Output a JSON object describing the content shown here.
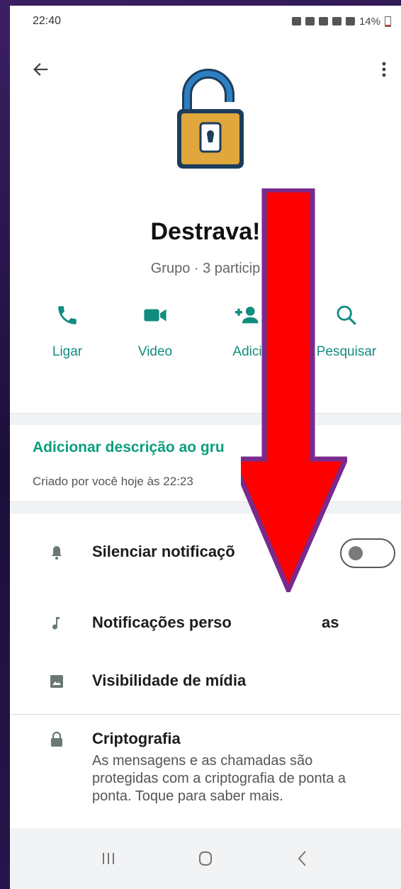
{
  "status_bar": {
    "time": "22:40",
    "battery": "14%"
  },
  "group": {
    "name": "Destrava!",
    "subtitle": "Grupo · 3 particip"
  },
  "actions": [
    {
      "label": "Ligar",
      "icon": "phone-icon"
    },
    {
      "label": "Video",
      "icon": "video-icon"
    },
    {
      "label": "Adici",
      "icon": "add-person-icon"
    },
    {
      "label": "Pesquisar",
      "icon": "search-icon"
    }
  ],
  "description": {
    "add_link": "Adicionar descrição ao gru",
    "created": "Criado por você hoje às 22:23"
  },
  "settings": [
    {
      "label": "Silenciar notificaçõ",
      "icon": "bell-icon",
      "toggle": false
    },
    {
      "label": "Notificações perso",
      "label_end": "as",
      "icon": "music-note-icon"
    },
    {
      "label": "Visibilidade de mídia",
      "icon": "image-icon"
    }
  ],
  "encryption": {
    "title": "Criptografia",
    "description": "As mensagens e as chamadas são protegidas com a criptografia de ponta a ponta. Toque para saber mais."
  },
  "colors": {
    "accent": "#128c7e",
    "link_green": "#0a9e7a",
    "arrow_red": "#ff0000",
    "arrow_border": "#7a2a8c"
  }
}
